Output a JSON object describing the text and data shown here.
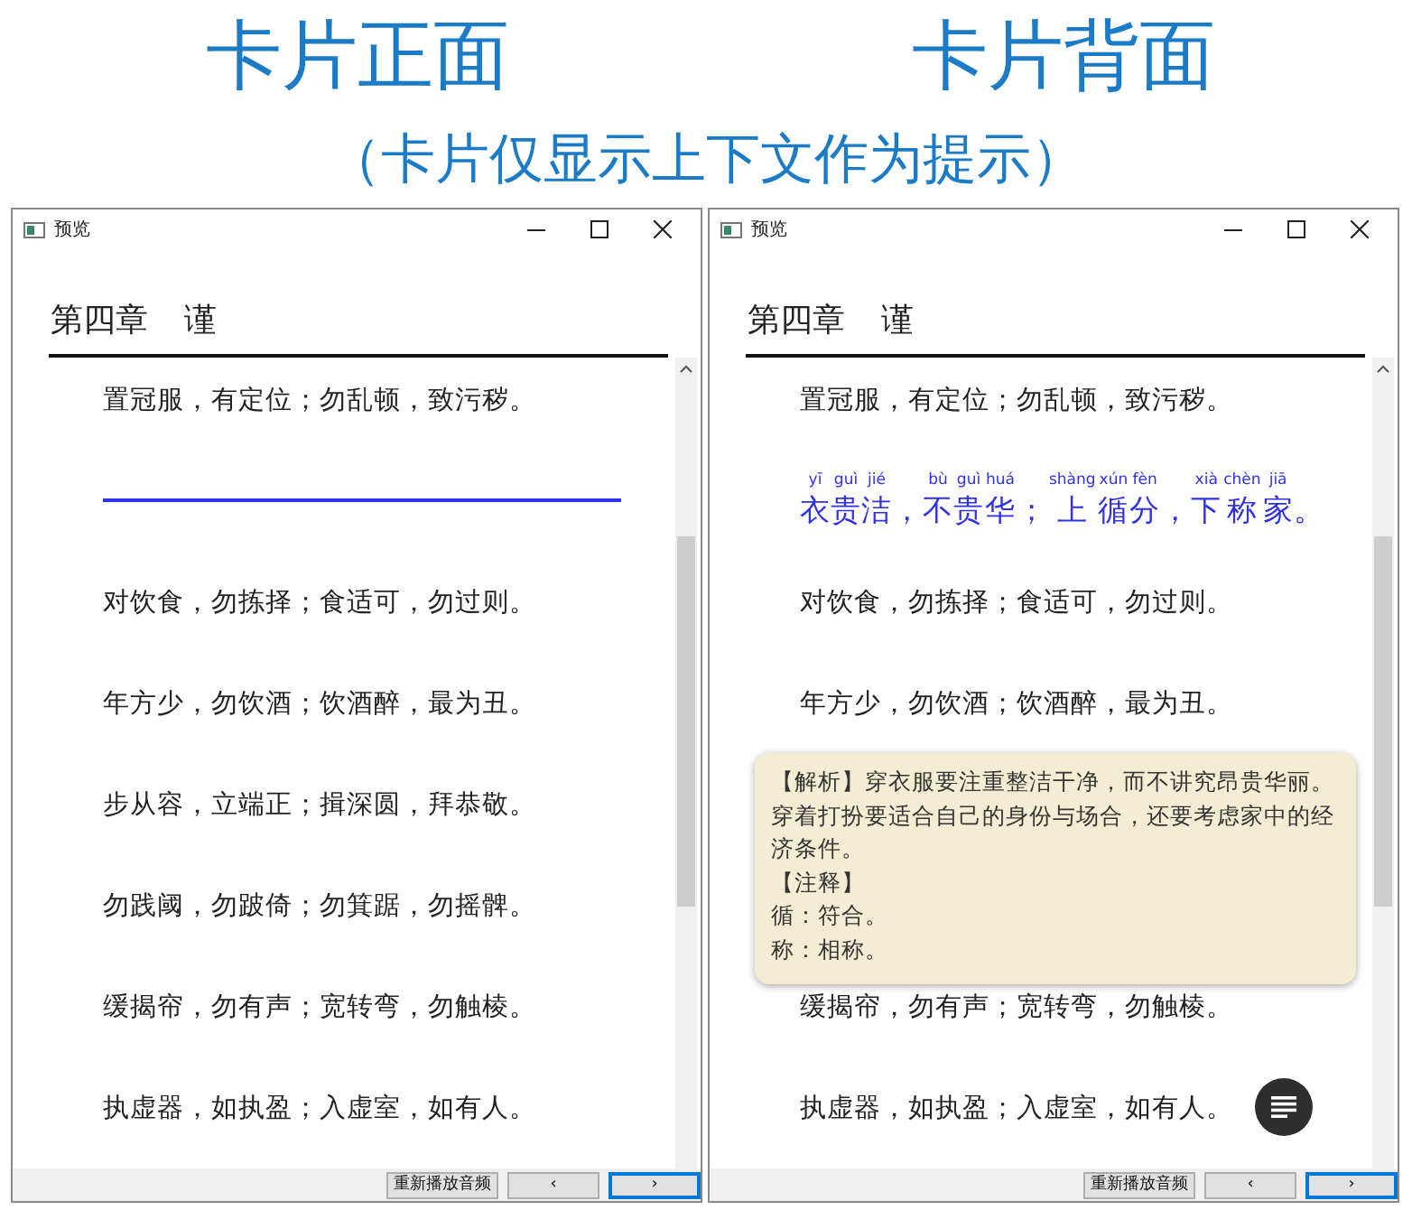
{
  "headings": [
    "卡片正面",
    "卡片背面"
  ],
  "subtitle": "（卡片仅显示上下文作为提示）",
  "windows": [
    {
      "title": "预览",
      "chapter": "第四章",
      "chapter_title": "谨",
      "lines": [
        {
          "kind": "text",
          "text": "置冠服，有定位；勿乱顿，致污秽。"
        },
        {
          "kind": "blank"
        },
        {
          "kind": "text",
          "text": "对饮食，勿拣择；食适可，勿过则。"
        },
        {
          "kind": "text",
          "text": "年方少，勿饮酒；饮酒醉，最为丑。"
        },
        {
          "kind": "text",
          "text": "步从容，立端正；揖深圆，拜恭敬。"
        },
        {
          "kind": "text",
          "text": "勿践阈，勿跛倚；勿箕踞，勿摇髀。"
        },
        {
          "kind": "text",
          "text": "缓揭帘，勿有声；宽转弯，勿触棱。"
        },
        {
          "kind": "text",
          "text": "执虚器，如执盈；入虚室，如有人。"
        }
      ],
      "buttons": [
        {
          "label": "重新播放音频",
          "focused": false
        },
        {
          "label": "‹",
          "focused": false
        },
        {
          "label": "›",
          "focused": true
        }
      ]
    },
    {
      "title": "预览",
      "chapter": "第四章",
      "chapter_title": "谨",
      "lines": [
        {
          "kind": "text",
          "text": "置冠服，有定位；勿乱顿，致污秽。"
        },
        {
          "kind": "ruby",
          "chars": [
            {
              "han": "衣",
              "pinyin": "yī"
            },
            {
              "han": "贵",
              "pinyin": "guì"
            },
            {
              "han": "洁",
              "pinyin": "jié"
            },
            {
              "han": "，"
            },
            {
              "han": "不",
              "pinyin": "bù"
            },
            {
              "han": "贵",
              "pinyin": "guì"
            },
            {
              "han": "华",
              "pinyin": "huá"
            },
            {
              "han": "；"
            },
            {
              "han": "上",
              "pinyin": "shàng"
            },
            {
              "han": "循",
              "pinyin": "xún"
            },
            {
              "han": "分",
              "pinyin": "fèn"
            },
            {
              "han": "，"
            },
            {
              "han": "下",
              "pinyin": "xià"
            },
            {
              "han": "称",
              "pinyin": "chèn"
            },
            {
              "han": "家",
              "pinyin": "jiā"
            },
            {
              "han": "。"
            }
          ]
        },
        {
          "kind": "text",
          "text": "对饮食，勿拣择；食适可，勿过则。"
        },
        {
          "kind": "text",
          "text": "年方少，勿饮酒；饮酒醉，最为丑。"
        },
        {
          "kind": "popup",
          "paragraphs": [
            "【解析】穿衣服要注重整洁干净，而不讲究昂贵华丽。穿着打扮要适合自己的身份与场合，还要考虑家中的经济条件。",
            "【注释】",
            "循：符合。",
            "称：相称。"
          ]
        },
        {
          "kind": "text",
          "text": "缓揭帘，勿有声；宽转弯，勿触棱。"
        },
        {
          "kind": "text",
          "text": "执虚器，如执盈；入虚室，如有人。",
          "menu": true
        }
      ],
      "buttons": [
        {
          "label": "重新播放音频",
          "focused": false
        },
        {
          "label": "‹",
          "focused": false
        },
        {
          "label": "›",
          "focused": true
        }
      ]
    }
  ]
}
